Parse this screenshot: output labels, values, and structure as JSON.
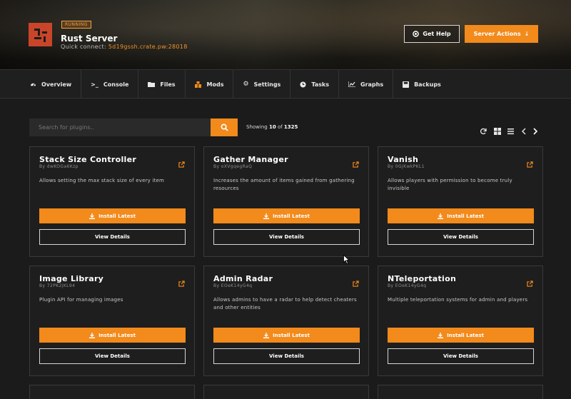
{
  "header": {
    "status_badge": "RUNNING",
    "server_name": "Rust Server",
    "quick_connect_label": "Quick connect:",
    "quick_connect_address": "5d19gssh.crate.pw:28018",
    "help_button": "Get Help",
    "actions_button": "Server Actions",
    "accent_color": "#f28a1c"
  },
  "nav": {
    "items": [
      {
        "label": "Overview",
        "icon": "dashboard-icon"
      },
      {
        "label": "Console",
        "icon": "terminal-icon"
      },
      {
        "label": "Files",
        "icon": "folder-icon"
      },
      {
        "label": "Mods",
        "icon": "puzzle-icon"
      },
      {
        "label": "Settings",
        "icon": "gear-icon"
      },
      {
        "label": "Tasks",
        "icon": "clock-icon"
      },
      {
        "label": "Graphs",
        "icon": "chart-icon"
      },
      {
        "label": "Backups",
        "icon": "save-icon"
      }
    ]
  },
  "search": {
    "placeholder": "Search for plugins..",
    "value": ""
  },
  "results": {
    "prefix": "Showing",
    "count": "10",
    "of": "of",
    "total": "1325"
  },
  "plugins": [
    {
      "name": "Stack Size Controller",
      "id": "By dwKOGa6Kzp",
      "desc": "Allows setting the max stack size of every item"
    },
    {
      "name": "Gather Manager",
      "id": "By oXVgqegRaQ",
      "desc": "Increases the amount of items gained from gathering resources"
    },
    {
      "name": "Vanish",
      "id": "By 0GjKwkPKL1",
      "desc": "Allows players with permission to become truly invisible"
    },
    {
      "name": "Image Library",
      "id": "By 72PK2jKL94",
      "desc": "Plugin API for managing images"
    },
    {
      "name": "Admin Radar",
      "id": "By EOeK14yG4q",
      "desc": "Allows admins to have a radar to help detect cheaters and other entities"
    },
    {
      "name": "NTeleportation",
      "id": "By EOeK14yG4q",
      "desc": "Multiple teleportation systems for admin and players"
    }
  ],
  "card_buttons": {
    "install": "Install Latest",
    "details": "View Details"
  }
}
